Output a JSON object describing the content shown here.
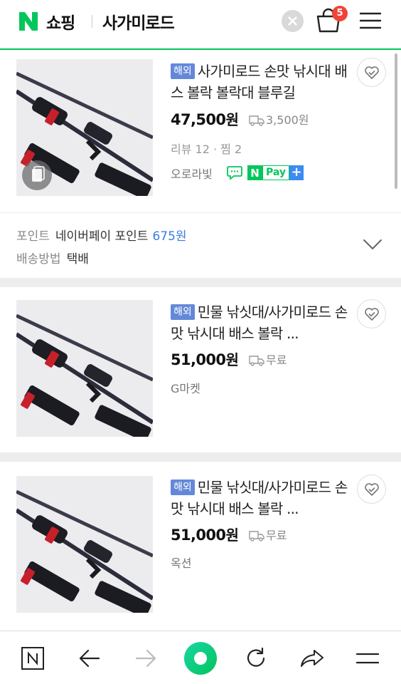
{
  "header": {
    "logo": "N",
    "service": "쇼핑",
    "query": "사가미로드",
    "cart_count": "5",
    "icons": [
      "clear-icon",
      "cart-icon",
      "menu-icon"
    ]
  },
  "products": [
    {
      "tag": "해외",
      "title": "사가미로드 손맛 낚시대 배스 볼락 볼락대 블루길",
      "price": "47,500",
      "won": "원",
      "shipping": "3,500원",
      "reviews": "리뷰 12",
      "dot": "·",
      "zzim": "찜 2",
      "seller": "오로라빛",
      "npay": {
        "n": "N",
        "pay": "Pay",
        "plus": "+"
      }
    },
    {
      "tag": "해외",
      "title": "민물 낚싯대/사가미로드 손맛 낚시대 배스 볼락 ...",
      "price": "51,000",
      "won": "원",
      "shipping": "무료",
      "seller": "G마켓"
    },
    {
      "tag": "해외",
      "title": "민물 낚싯대/사가미로드 손맛 낚시대 배스 볼락 ...",
      "price": "51,000",
      "won": "원",
      "shipping": "무료",
      "seller": "옥션"
    }
  ],
  "info": {
    "point_label": "포인트",
    "point_value": "네이버페이 포인트",
    "point_amount": "675원",
    "delivery_label": "배송방법",
    "delivery_value": "택배"
  },
  "toolbar": {
    "buttons": [
      "home-icon",
      "back-icon",
      "forward-icon",
      "green-dot-icon",
      "reload-icon",
      "share-icon",
      "menu-icon"
    ]
  },
  "colors": {
    "brand_green": "#03c75a",
    "tag_blue": "#6488d9",
    "badge_red": "#f04438",
    "point_blue": "#3a7ce0"
  }
}
